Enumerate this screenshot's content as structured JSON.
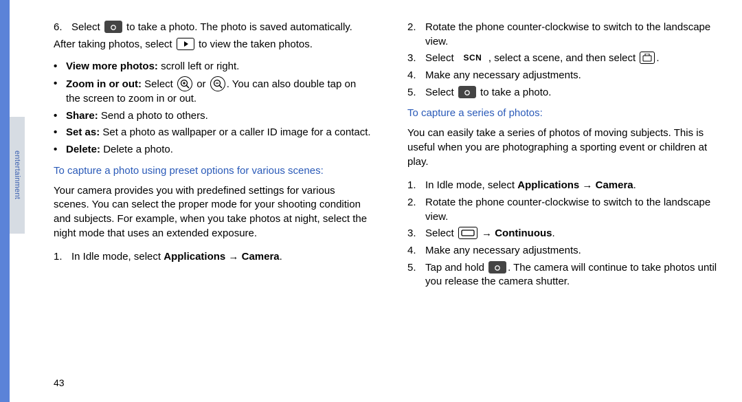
{
  "sidebar": {
    "label": "entertainment"
  },
  "page_number": "43",
  "left": {
    "step6": {
      "num": "6.",
      "pre": "Select ",
      "post": " to take a photo. The photo is saved automatically."
    },
    "after_photos": {
      "pre": "After taking photos, select ",
      "post": " to view the taken photos."
    },
    "bullets": {
      "view_more": {
        "label": "View more photos:",
        "text": " scroll left or right."
      },
      "zoom": {
        "label": "Zoom in or out:",
        "pre": " Select ",
        "mid": " or ",
        "post": ". You can also double tap on the screen to zoom in or out."
      },
      "share": {
        "label": "Share:",
        "text": " Send a photo to others."
      },
      "setas": {
        "label": "Set as:",
        "text": " Set a photo as wallpaper or a caller ID image for a contact."
      },
      "delete": {
        "label": "Delete:",
        "text": " Delete a photo."
      }
    },
    "heading_preset": "To capture a photo using preset options for various scenes:",
    "preset_para": "Your camera provides you with predefined settings for various scenes. You can select the proper mode for your shooting condition and subjects. For example, when you take photos at night, select the night mode that uses an extended exposure.",
    "preset_step1": {
      "num": "1.",
      "pre": "In Idle mode, select ",
      "bold1": "Applications",
      "arrow": " → ",
      "bold2": "Camera",
      "post": "."
    }
  },
  "right": {
    "steps_a": {
      "s2": {
        "num": "2.",
        "text": "Rotate the phone counter-clockwise to switch to the landscape view."
      },
      "s3": {
        "num": "3.",
        "pre": "Select ",
        "mid": ", select a scene, and then select ",
        "post": "."
      },
      "s4": {
        "num": "4.",
        "text": "Make any necessary adjustments."
      },
      "s5": {
        "num": "5.",
        "pre": "Select ",
        "post": " to take a photo."
      }
    },
    "heading_series": "To capture a series of photos:",
    "series_para": "You can easily take a series of photos of moving subjects. This is useful when you are photographing a sporting event or children at play.",
    "steps_b": {
      "s1": {
        "num": "1.",
        "pre": "In Idle mode, select ",
        "bold1": "Applications",
        "arrow": " → ",
        "bold2": "Camera",
        "post": "."
      },
      "s2": {
        "num": "2.",
        "text": "Rotate the phone counter-clockwise to switch to the landscape view."
      },
      "s3": {
        "num": "3.",
        "pre": "Select ",
        "arrow": " → ",
        "bold": "Continuous",
        "post": "."
      },
      "s4": {
        "num": "4.",
        "text": "Make any necessary adjustments."
      },
      "s5": {
        "num": "5.",
        "pre": "Tap and hold ",
        "post": ". The camera will continue to take photos until you release the camera shutter."
      }
    }
  },
  "icons": {
    "scn_label": "SCN"
  }
}
